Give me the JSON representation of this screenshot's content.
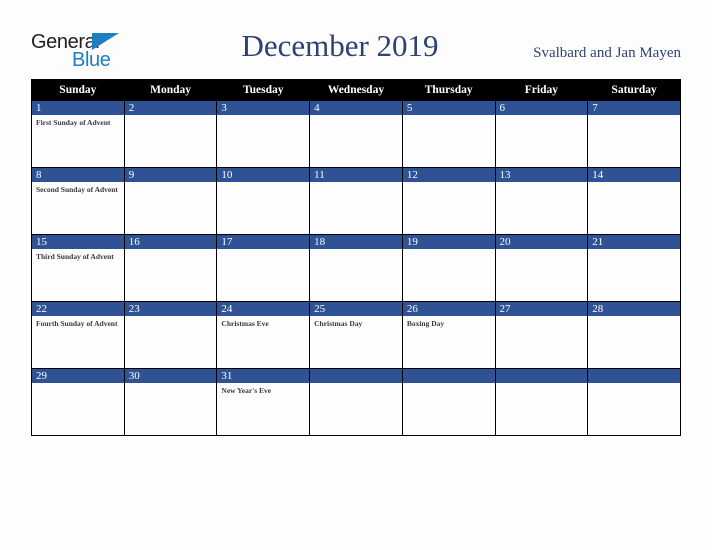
{
  "header": {
    "logo": {
      "word_one": "General",
      "word_two": "Blue",
      "triangle_color": "#1f7ec2"
    },
    "title": "December 2019",
    "subtitle": "Svalbard and Jan Mayen"
  },
  "calendar": {
    "accent_color": "#2e5293",
    "header_background": "#000000",
    "weekday_headers": [
      "Sunday",
      "Monday",
      "Tuesday",
      "Wednesday",
      "Thursday",
      "Friday",
      "Saturday"
    ],
    "weeks": [
      {
        "days": [
          {
            "num": "1",
            "events": [
              "First Sunday of Advent"
            ]
          },
          {
            "num": "2",
            "events": []
          },
          {
            "num": "3",
            "events": []
          },
          {
            "num": "4",
            "events": []
          },
          {
            "num": "5",
            "events": []
          },
          {
            "num": "6",
            "events": []
          },
          {
            "num": "7",
            "events": []
          }
        ]
      },
      {
        "days": [
          {
            "num": "8",
            "events": [
              "Second Sunday of Advent"
            ]
          },
          {
            "num": "9",
            "events": []
          },
          {
            "num": "10",
            "events": []
          },
          {
            "num": "11",
            "events": []
          },
          {
            "num": "12",
            "events": []
          },
          {
            "num": "13",
            "events": []
          },
          {
            "num": "14",
            "events": []
          }
        ]
      },
      {
        "days": [
          {
            "num": "15",
            "events": [
              "Third Sunday of Advent"
            ]
          },
          {
            "num": "16",
            "events": []
          },
          {
            "num": "17",
            "events": []
          },
          {
            "num": "18",
            "events": []
          },
          {
            "num": "19",
            "events": []
          },
          {
            "num": "20",
            "events": []
          },
          {
            "num": "21",
            "events": []
          }
        ]
      },
      {
        "days": [
          {
            "num": "22",
            "events": [
              "Fourth Sunday of Advent"
            ]
          },
          {
            "num": "23",
            "events": []
          },
          {
            "num": "24",
            "events": [
              "Christmas Eve"
            ]
          },
          {
            "num": "25",
            "events": [
              "Christmas Day"
            ]
          },
          {
            "num": "26",
            "events": [
              "Boxing Day"
            ]
          },
          {
            "num": "27",
            "events": []
          },
          {
            "num": "28",
            "events": []
          }
        ]
      },
      {
        "days": [
          {
            "num": "29",
            "events": []
          },
          {
            "num": "30",
            "events": []
          },
          {
            "num": "31",
            "events": [
              "New Year's Eve"
            ]
          },
          {
            "num": "",
            "events": []
          },
          {
            "num": "",
            "events": []
          },
          {
            "num": "",
            "events": []
          },
          {
            "num": "",
            "events": []
          }
        ]
      }
    ]
  }
}
